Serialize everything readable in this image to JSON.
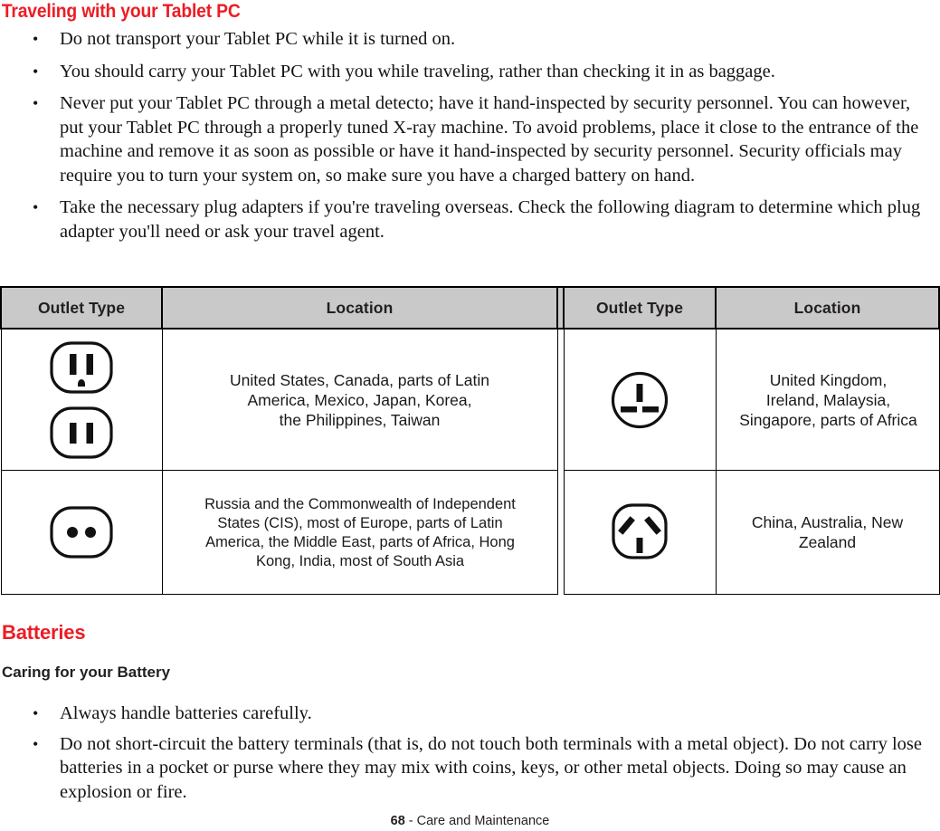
{
  "document": {
    "section_title": "Traveling with your Tablet PC",
    "travel_bullets": [
      "Do not transport your Tablet PC while it is turned on.",
      "You should carry your Tablet PC with you while traveling, rather than checking it in as baggage.",
      "Never put your Tablet PC through a metal detecto; have it hand-inspected by security personnel. You can however, put your Tablet PC through a properly tuned X-ray machine. To avoid problems, place it close to the entrance of the machine and remove it as soon as possible or have it hand-inspected by security personnel. Security officials may require you to turn your system on, so make sure you have a charged battery on hand.",
      "Take the necessary plug adapters if you're traveling overseas. Check the following diagram to determine which plug adapter you'll need or ask your travel agent."
    ],
    "batteries_title": "Batteries",
    "batteries_subtitle": "Caring for your Battery",
    "battery_bullets": [
      "Always handle batteries carefully.",
      "Do not short-circuit the battery terminals (that is, do not touch both terminals with a metal object). Do not carry lose batteries in a pocket or purse where they may mix with coins, keys, or other metal objects. Doing so may cause an explosion or fire."
    ],
    "footer": {
      "page_number": "68",
      "text": " - Care and Maintenance"
    }
  },
  "outlet_table": {
    "headers": {
      "outlet_type_left": "Outlet Type",
      "location_left": "Location",
      "outlet_type_right": "Outlet Type",
      "location_right": "Location"
    },
    "rows": [
      {
        "left_icon": "us-outlet-icon",
        "left_location": "United States, Canada, parts of Latin\nAmerica, Mexico, Japan, Korea,\nthe Philippines, Taiwan",
        "right_icon": "uk-outlet-icon",
        "right_location": "United Kingdom,\nIreland, Malaysia,\nSingapore, parts of Africa"
      },
      {
        "left_icon": "europlug-outlet-icon",
        "left_location": "Russia and the Commonwealth of Independent\nStates (CIS), most of Europe, parts of Latin\nAmerica, the Middle East, parts of Africa, Hong\nKong, India, most of South Asia",
        "right_icon": "australia-outlet-icon",
        "right_location": "China, Australia, New\nZealand"
      }
    ]
  },
  "colors": {
    "heading_red": "#ed1c24",
    "header_gray": "#c9c9c9",
    "text_black": "#1a1a1a"
  },
  "bullet_glyph": "•"
}
